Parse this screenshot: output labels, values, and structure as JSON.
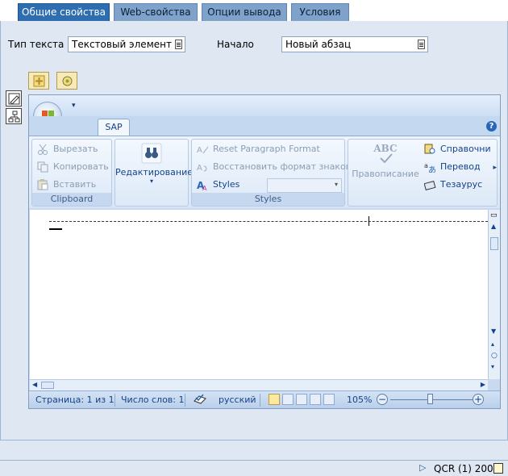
{
  "tabs": [
    {
      "label": "Общие свойства",
      "active": true
    },
    {
      "label": "Web-свойства",
      "active": false
    },
    {
      "label": "Опции вывода",
      "active": false
    },
    {
      "label": "Условия",
      "active": false
    }
  ],
  "form": {
    "text_type_label": "Тип текста",
    "text_type_value": "Текстовый элемент",
    "start_label": "Начало",
    "start_value": "Новый абзац"
  },
  "ribbon": {
    "tab_label": "SAP",
    "help_glyph": "?",
    "clipboard": {
      "cut": "Вырезать",
      "copy": "Копировать",
      "paste": "Вставить",
      "title": "Clipboard"
    },
    "editing": {
      "label": "Редактирование"
    },
    "styles": {
      "reset": "Reset Paragraph Format",
      "restore": "Восстановить формат знаков",
      "styles": "Styles",
      "title": "Styles"
    },
    "proofing": {
      "spelling_icon_text": "ABC",
      "spelling": "Правописание",
      "reference": "Справочни",
      "translate": "Перевод",
      "thesaurus": "Тезаурус"
    }
  },
  "statusbar": {
    "page": "Страница: 1 из 1",
    "words": "Число слов: 1",
    "language": "русский",
    "zoom": "105%",
    "zoom_level_percent": 105
  },
  "footer": {
    "system": "QCR (1) 200"
  },
  "colors": {
    "active_tab": "#2d6db0",
    "inactive_tab": "#7ea2c9",
    "panel_bg": "#dfe8f2"
  }
}
